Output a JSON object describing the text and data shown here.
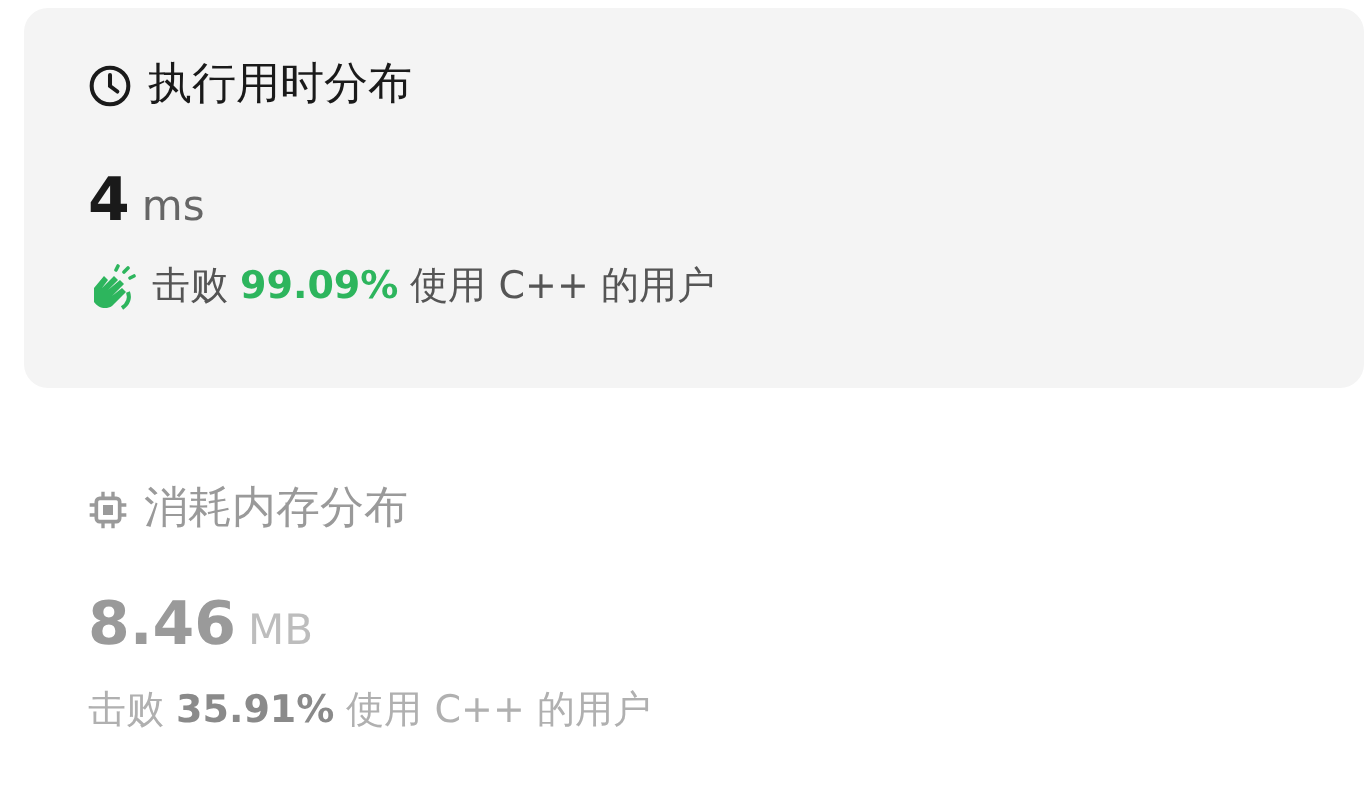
{
  "panels": [
    {
      "kind": "runtime",
      "title": "执行用时分布",
      "value": "4",
      "unit": "ms",
      "beats": "击败 **99.09%** 使用 C++ 的用户",
      "selected": true
    },
    {
      "kind": "memory",
      "title": "消耗内存分布",
      "value": "8.46",
      "unit": "MB",
      "beats": "击败 **35.91%** 使用 C++ 的用户",
      "selected": false
    }
  ]
}
